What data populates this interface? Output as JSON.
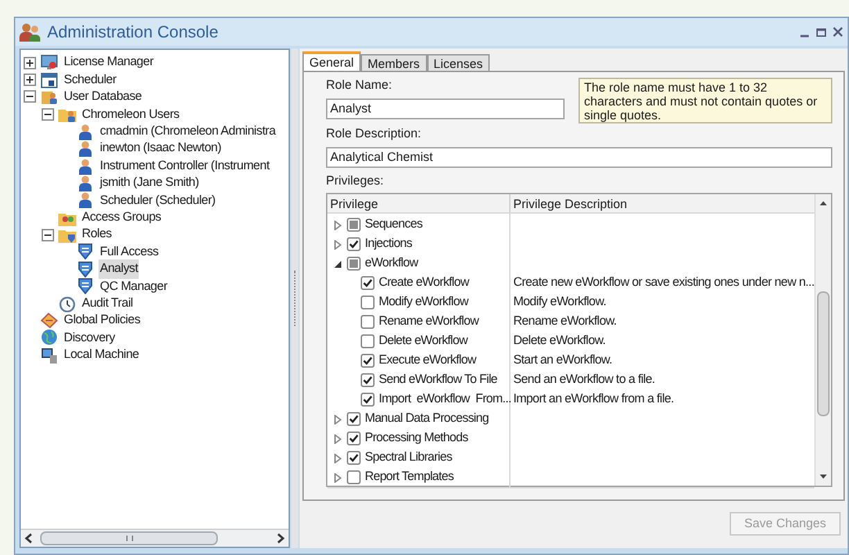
{
  "window": {
    "title": "Administration Console"
  },
  "tree": [
    {
      "label": "License Manager",
      "kind": "monitor",
      "expanded": false,
      "selected": false
    },
    {
      "label": "Scheduler",
      "kind": "calendar",
      "expanded": false,
      "selected": false
    },
    {
      "label": "User Database",
      "kind": "database",
      "expanded": true,
      "selected": false,
      "children": [
        {
          "label": "Chromeleon Users",
          "kind": "users-folder",
          "expanded": true,
          "selected": false,
          "children": [
            {
              "label": "cmadmin (Chromeleon Administra",
              "kind": "user",
              "selected": false
            },
            {
              "label": "inewton (Isaac Newton)",
              "kind": "user",
              "selected": false
            },
            {
              "label": "Instrument Controller (Instrument",
              "kind": "user",
              "selected": false
            },
            {
              "label": "jsmith (Jane Smith)",
              "kind": "user",
              "selected": false
            },
            {
              "label": "Scheduler (Scheduler)",
              "kind": "user",
              "selected": false
            }
          ]
        },
        {
          "label": "Access Groups",
          "kind": "group",
          "selected": false
        },
        {
          "label": "Roles",
          "kind": "roles-folder",
          "expanded": true,
          "selected": false,
          "children": [
            {
              "label": "Full Access",
              "kind": "shield",
              "selected": false
            },
            {
              "label": "Analyst",
              "kind": "shield",
              "selected": true
            },
            {
              "label": "QC Manager",
              "kind": "shield",
              "selected": false
            }
          ]
        },
        {
          "label": "Audit Trail",
          "kind": "clock",
          "selected": false
        }
      ]
    },
    {
      "label": "Global Policies",
      "kind": "policy",
      "selected": false
    },
    {
      "label": "Discovery",
      "kind": "globe",
      "selected": false
    },
    {
      "label": "Local Machine",
      "kind": "computer",
      "selected": false
    }
  ],
  "tabs": [
    {
      "label": "General",
      "selected": true
    },
    {
      "label": "Members",
      "selected": false
    },
    {
      "label": "Licenses",
      "selected": false
    }
  ],
  "role_name": {
    "label": "Role Name:",
    "value": "Analyst"
  },
  "hint": "The role name must have 1 to 32 characters and must not contain quotes or single quotes.",
  "role_description": {
    "label": "Role Description:",
    "value": "Analytical Chemist"
  },
  "privileges": {
    "label": "Privileges:",
    "columns": [
      "Privilege",
      "Privilege Description"
    ],
    "rows": [
      {
        "name": "Sequences",
        "checked": false,
        "mixed": true,
        "expanded": false
      },
      {
        "name": "Injections",
        "checked": true,
        "mixed": false,
        "expanded": false
      },
      {
        "name": "eWorkflow",
        "checked": false,
        "mixed": true,
        "expanded": true,
        "children": [
          {
            "name": "Create eWorkflow",
            "checked": true,
            "description": "Create new eWorkflow or save existing ones under new n..."
          },
          {
            "name": "Modify eWorkflow",
            "checked": false,
            "description": "Modify eWorkflow."
          },
          {
            "name": "Rename eWorkflow",
            "checked": false,
            "description": "Rename eWorkflow."
          },
          {
            "name": "Delete eWorkflow",
            "checked": false,
            "description": "Delete eWorkflow."
          },
          {
            "name": "Execute eWorkflow",
            "checked": true,
            "description": "Start an eWorkflow."
          },
          {
            "name": "Send eWorkflow To File",
            "checked": true,
            "description": "Send an eWorkflow to a file."
          },
          {
            "name": "Import  eWorkflow  From...",
            "checked": true,
            "description": "Import an eWorkflow from a file."
          }
        ]
      },
      {
        "name": "Manual Data Processing",
        "checked": true,
        "mixed": false,
        "expanded": false
      },
      {
        "name": "Processing Methods",
        "checked": true,
        "mixed": false,
        "expanded": false
      },
      {
        "name": "Spectral Libraries",
        "checked": true,
        "mixed": false,
        "expanded": false
      },
      {
        "name": "Report Templates",
        "checked": false,
        "mixed": false,
        "expanded": false
      }
    ]
  },
  "save_button": {
    "label": "Save Changes",
    "disabled": true
  }
}
